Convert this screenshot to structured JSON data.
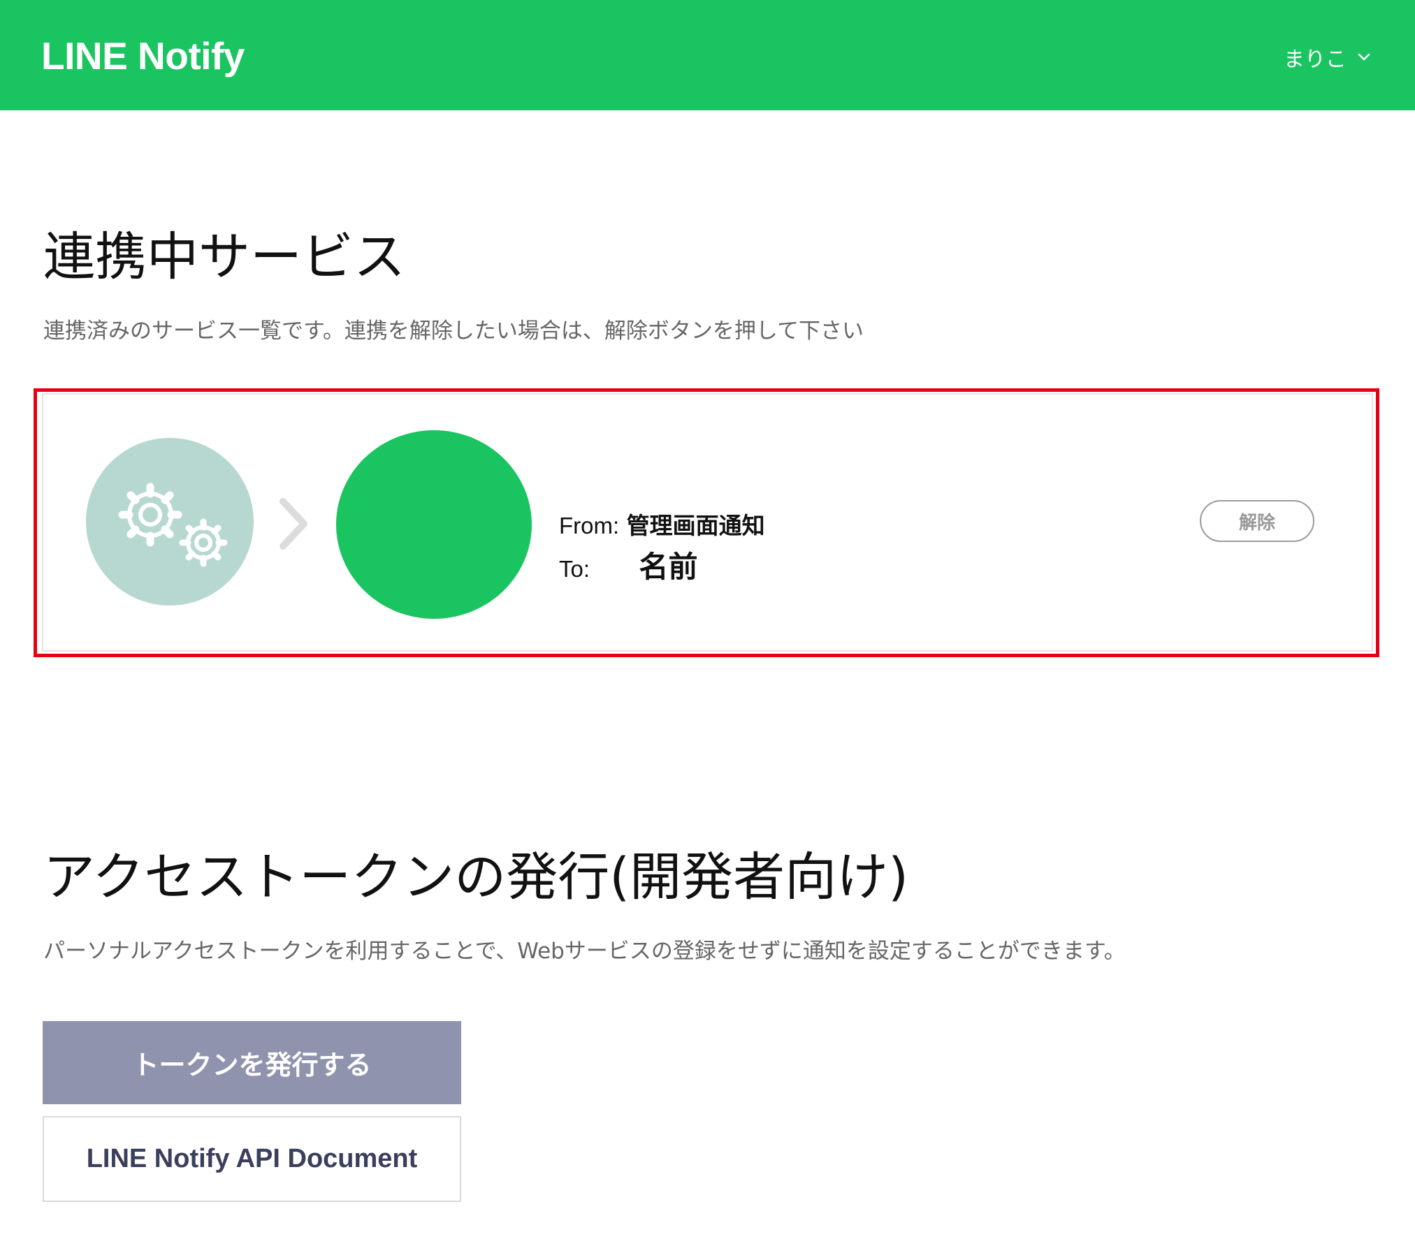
{
  "header": {
    "logo": "LINE Notify",
    "user_name": "まりこ",
    "user_menu_icon": "chevron-down-icon",
    "background_color": "#1ac460"
  },
  "connected": {
    "title": "連携中サービス",
    "description": "連携済みのサービス一覧です。連携を解除したい場合は、解除ボタンを押して下さい",
    "service": {
      "icon": "gears-icon",
      "arrow_icon": "chevron-right-icon",
      "from_label": "From:",
      "from_value": "管理画面通知",
      "to_label": "To:",
      "to_value": "名前",
      "unlink_label": "解除"
    },
    "highlight_color": "#e60012"
  },
  "token": {
    "title": "アクセストークンの発行(開発者向け)",
    "description": "パーソナルアクセストークンを利用することで、Webサービスの登録をせずに通知を設定することができます。",
    "issue_button": "トークンを発行する",
    "doc_button": "LINE Notify API Document"
  }
}
